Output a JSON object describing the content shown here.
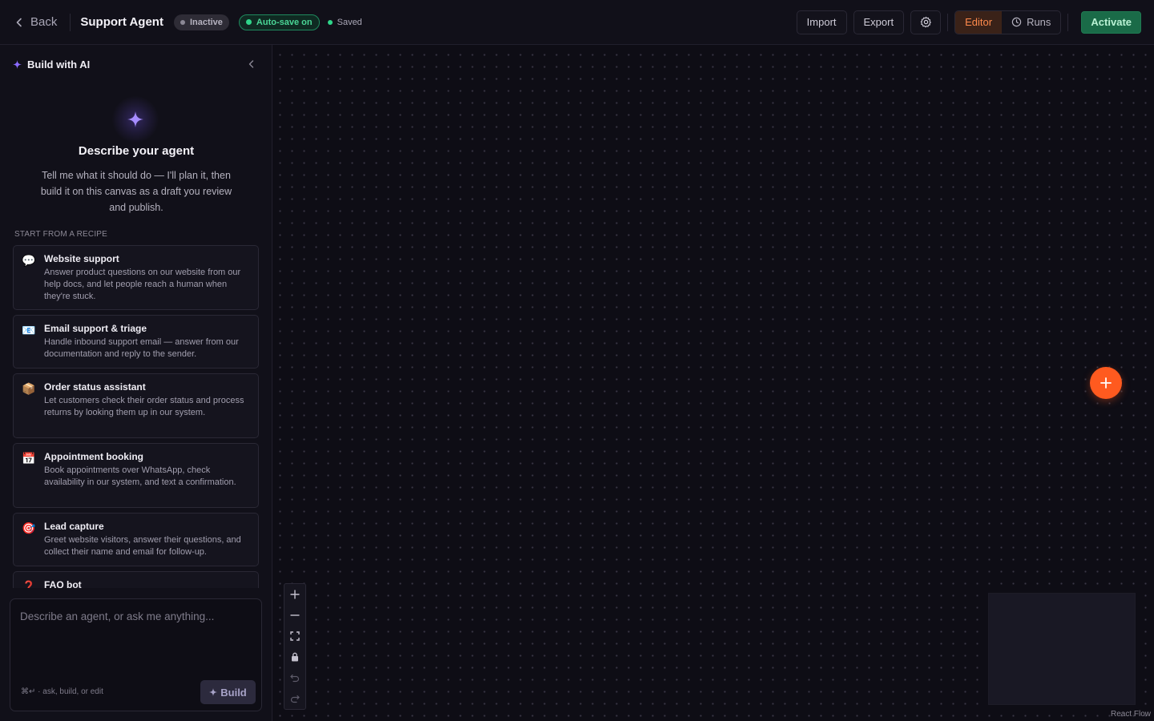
{
  "topbar": {
    "back_label": "Back",
    "title": "Support Agent",
    "status": "Inactive",
    "autosave": "Auto-save on",
    "saved": "Saved",
    "import_label": "Import",
    "export_label": "Export",
    "editor_label": "Editor",
    "runs_label": "Runs",
    "activate_label": "Activate"
  },
  "sidebar": {
    "title": "Build with AI",
    "hero_title": "Describe your agent",
    "hero_desc": "Tell me what it should do — I'll plan it, then build it on this canvas as a draft you review and publish.",
    "recipes_label": "START FROM A RECIPE",
    "recipes": [
      {
        "icon": "💬",
        "title": "Website support",
        "desc": "Answer product questions on our website from our help docs, and let people reach a human when they're stuck."
      },
      {
        "icon": "📧",
        "title": "Email support & triage",
        "desc": "Handle inbound support email — answer from our documentation and reply to the sender."
      },
      {
        "icon": "📦",
        "title": "Order status assistant",
        "desc": "Let customers check their order status and process returns by looking them up in our system."
      },
      {
        "icon": "📅",
        "title": "Appointment booking",
        "desc": "Book appointments over WhatsApp, check availability in our system, and text a confirmation."
      },
      {
        "icon": "🎯",
        "title": "Lead capture",
        "desc": "Greet website visitors, answer their questions, and collect their name and email for follow-up."
      },
      {
        "icon": "❓",
        "title": "FAQ bot",
        "desc": ""
      }
    ],
    "composer": {
      "placeholder": "Describe an agent, or ask me anything...",
      "hint": "⌘↵ · ask, build, or edit",
      "build_label": "Build"
    }
  },
  "canvas": {
    "attribution": "React Flow"
  },
  "colors": {
    "accent_orange": "#ff5a1f",
    "success_green": "#2fd68a",
    "ai_purple": "#8b6bff"
  }
}
